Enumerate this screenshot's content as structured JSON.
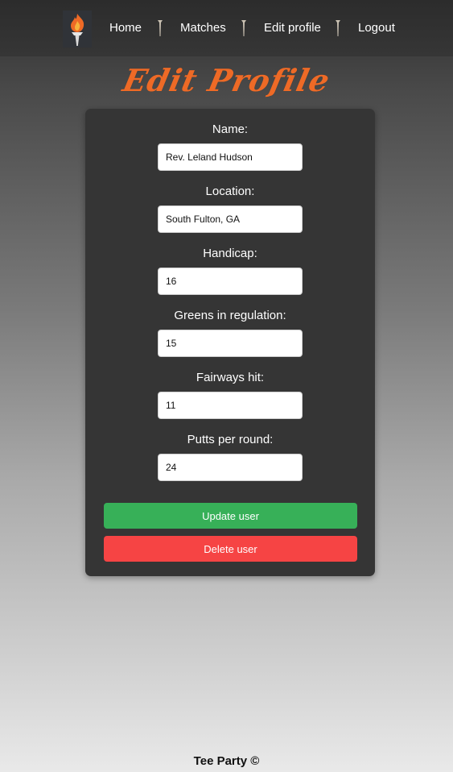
{
  "nav": {
    "logo_icon": "torch-icon",
    "links": [
      "Home",
      "Matches",
      "Edit profile",
      "Logout"
    ],
    "separator_icon": "golf-tee-icon"
  },
  "page": {
    "title": "Edit Profile",
    "title_color": "#ee6a26"
  },
  "form": {
    "fields": [
      {
        "label": "Name:",
        "value": "Rev. Leland Hudson"
      },
      {
        "label": "Location:",
        "value": "South Fulton, GA"
      },
      {
        "label": "Handicap:",
        "value": "16"
      },
      {
        "label": "Greens in regulation:",
        "value": "15"
      },
      {
        "label": "Fairways hit:",
        "value": "11"
      },
      {
        "label": "Putts per round:",
        "value": "24"
      }
    ],
    "update_label": "Update user",
    "delete_label": "Delete user",
    "update_color": "#37b058",
    "delete_color": "#f64444"
  },
  "footer": {
    "text": "Tee Party ©"
  }
}
